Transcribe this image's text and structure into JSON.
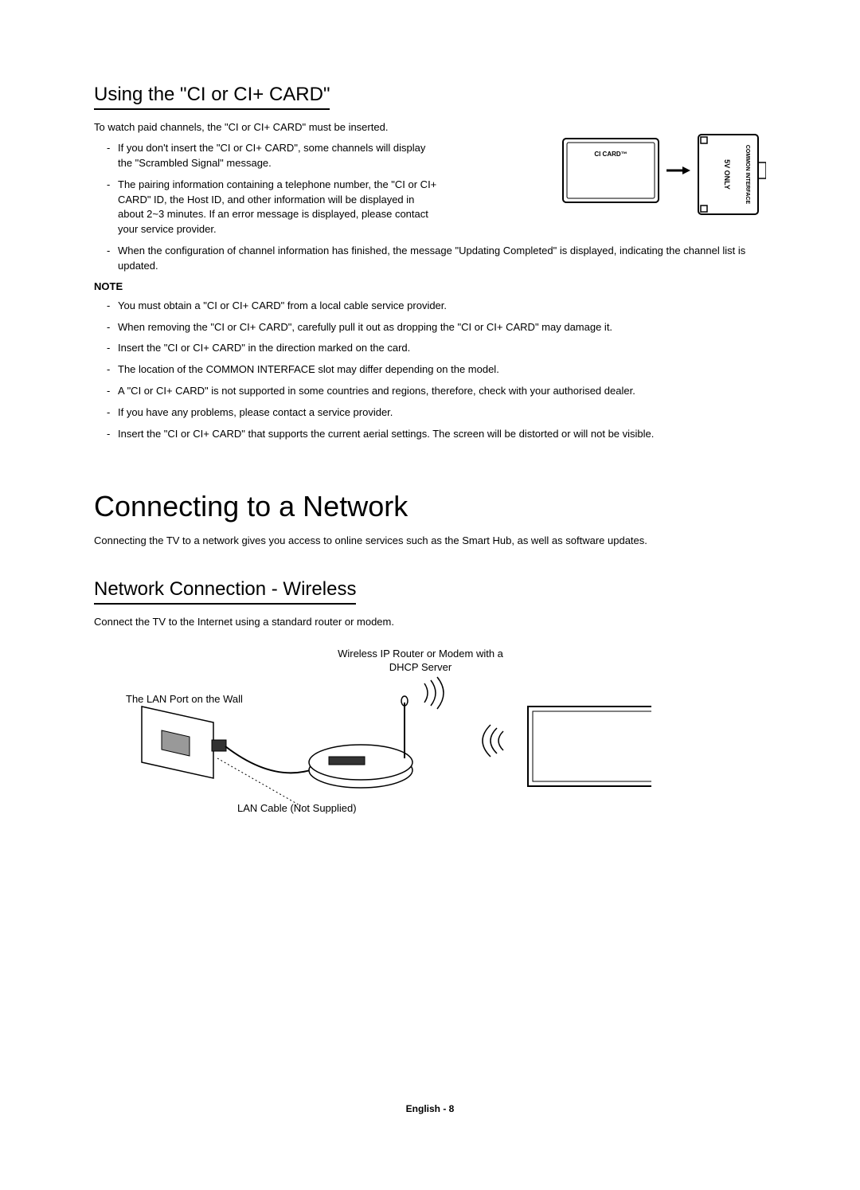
{
  "section1": {
    "title": "Using the \"CI or CI+ CARD\"",
    "intro": "To watch paid channels, the \"CI or CI+ CARD\" must be inserted.",
    "bullets_top": [
      "If you don't insert the \"CI or CI+ CARD\", some channels will display the \"Scrambled Signal\" message.",
      "The pairing information containing a telephone number, the \"CI or CI+ CARD\" ID, the Host ID, and other information will be displayed in about 2~3 minutes. If an error message is displayed, please contact your service provider."
    ],
    "bullets_full": [
      "When the configuration of channel information has finished, the message \"Updating Completed\" is displayed, indicating the channel list is updated."
    ],
    "note_label": "NOTE",
    "note_bullets": [
      "You must obtain a \"CI or CI+ CARD\" from a local cable service provider.",
      "When removing the \"CI or CI+ CARD\", carefully pull it out as dropping the \"CI or CI+ CARD\" may damage it.",
      "Insert the \"CI or CI+ CARD\" in the direction marked on the card.",
      "The location of the COMMON INTERFACE slot may differ depending on the model.",
      "A \"CI or CI+ CARD\" is not supported in some countries and regions, therefore, check with your authorised dealer.",
      "If you have any problems, please contact a service provider.",
      "Insert the \"CI or CI+ CARD\" that supports the current aerial settings. The screen will be distorted or will not be visible."
    ],
    "diagram": {
      "card_label": "CI CARD™",
      "slot_label_1": "5V ONLY",
      "slot_label_2": "COMMON INTERFACE"
    }
  },
  "section2": {
    "title": "Connecting to a Network",
    "intro": "Connecting the TV to a network gives you access to online services such as the Smart Hub, as well as software updates."
  },
  "section3": {
    "title": "Network Connection - Wireless",
    "intro": "Connect the TV to the Internet using a standard router or modem.",
    "labels": {
      "router": "Wireless IP Router or Modem with a DHCP Server",
      "lan_port": "The LAN Port on the Wall",
      "lan_cable": "LAN Cable (Not Supplied)"
    }
  },
  "footer": {
    "page": "English - 8"
  }
}
